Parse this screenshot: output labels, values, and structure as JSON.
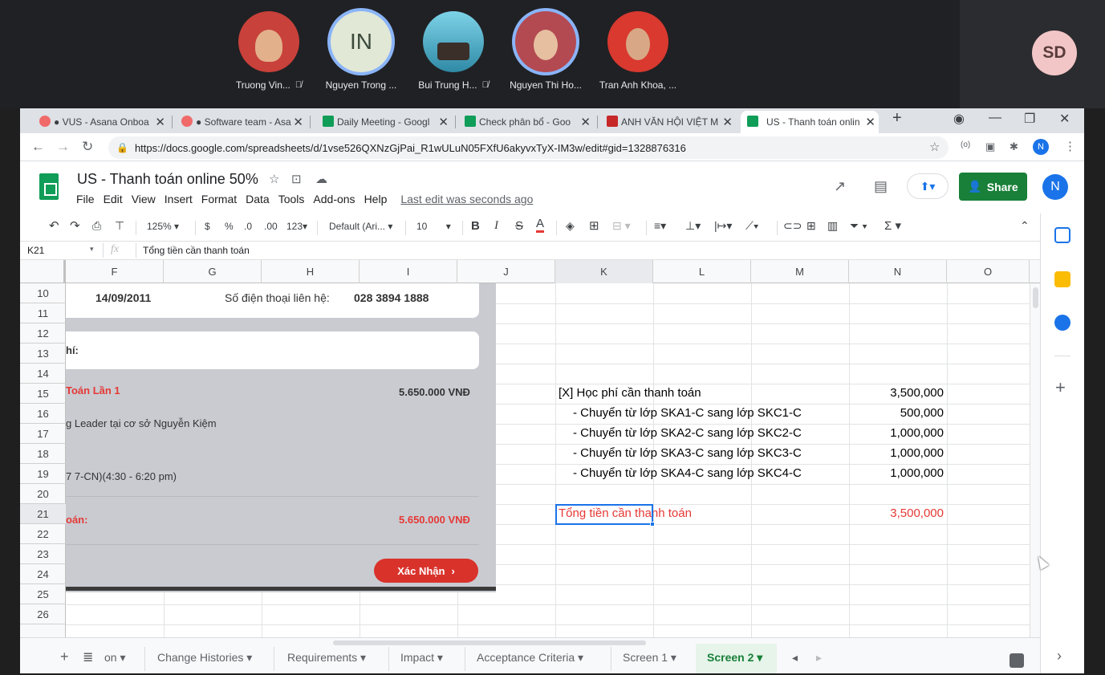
{
  "meeting": {
    "participants": [
      {
        "name": "Truong Vin...",
        "initials": "",
        "muted": true,
        "photo_color": "#c8413a",
        "ring": false
      },
      {
        "name": "Nguyen Trong ...",
        "initials": "IN",
        "muted": false,
        "photo_color": "#e2e8d6",
        "ring": true
      },
      {
        "name": "Bui Trung H...",
        "initials": "",
        "muted": true,
        "photo_color": "#49b6c9",
        "ring": false
      },
      {
        "name": "Nguyen Thi Ho...",
        "initials": "",
        "muted": false,
        "photo_color": "#b34a52",
        "ring": true
      },
      {
        "name": "Tran Anh Khoa, ...",
        "initials": "",
        "muted": false,
        "photo_color": "#d9392f",
        "ring": false
      }
    ],
    "self_initials": "SD"
  },
  "browser": {
    "tabs": [
      {
        "label": "● VUS - Asana Onboa",
        "icon_color": "#f06a6a"
      },
      {
        "label": "● Software team - Asa",
        "icon_color": "#f06a6a"
      },
      {
        "label": "Daily Meeting - Googl",
        "icon_color": "#0f9d58"
      },
      {
        "label": "Check phân bổ - Goo",
        "icon_color": "#0f9d58"
      },
      {
        "label": "ANH VĂN HỘI VIỆT M",
        "icon_color": "#c62828"
      },
      {
        "label": "US - Thanh toán onlin",
        "icon_color": "#0f9d58"
      }
    ],
    "new_tab": "+",
    "url": "https://docs.google.com/spreadsheets/d/1vse526QXNzGjPai_R1wULuN05FXfU6akyvxTyX-IM3w/edit#gid=1328876316",
    "profile_initial": "N"
  },
  "doc": {
    "title": "US - Thanh toán online 50%",
    "menu": [
      "File",
      "Edit",
      "View",
      "Insert",
      "Format",
      "Data",
      "Tools",
      "Add-ons",
      "Help"
    ],
    "last_edit": "Last edit was seconds ago",
    "share_label": "Share",
    "account_initial": "N"
  },
  "toolbar": {
    "zoom": "125%",
    "currency": "$",
    "percent": "%",
    "dec_less": ".0",
    "dec_more": ".00",
    "format_more": "123",
    "font": "Default (Ari...",
    "font_size": "10",
    "bold": "B",
    "italic": "I",
    "strike": "S",
    "text_color": "A",
    "sum": "Σ"
  },
  "formula_bar": {
    "cell_ref": "K21",
    "fx": "fx",
    "content": "Tổng tiền cần thanh toán"
  },
  "grid": {
    "columns": [
      "F",
      "G",
      "H",
      "I",
      "J",
      "K",
      "L",
      "M",
      "N",
      "O"
    ],
    "rows": [
      "10",
      "11",
      "12",
      "13",
      "14",
      "15",
      "16",
      "17",
      "18",
      "19",
      "20",
      "21",
      "22",
      "23",
      "24",
      "25",
      "26"
    ],
    "selected_column": "K",
    "selected_row": "21",
    "cells": [
      {
        "text": "[X] Học phí cần thanh toán",
        "value": "3,500,000",
        "red": false
      },
      {
        "text": "- Chuyển từ lớp SKA1-C sang lớp SKC1-C",
        "value": "500,000",
        "red": false
      },
      {
        "text": "- Chuyển từ lớp SKA2-C sang lớp SKC2-C",
        "value": "1,000,000",
        "red": false
      },
      {
        "text": "- Chuyển từ lớp SKA3-C sang lớp SKC3-C",
        "value": "1,000,000",
        "red": false
      },
      {
        "text": "- Chuyển từ lớp SKA4-C sang lớp SKC4-C",
        "value": "1,000,000",
        "red": false
      },
      {
        "text": "Tổng tiền cần thanh toán",
        "value": "3,500,000",
        "red": true
      }
    ]
  },
  "embed": {
    "date": "14/09/2011",
    "phone_label": "Số điện thoại liên hệ:",
    "phone": "028 3894 1888",
    "fee_header": "hí:",
    "installment": "Toán Lần 1",
    "installment_amount": "5.650.000 VNĐ",
    "course": "g Leader tại cơ sở Nguyễn Kiệm",
    "schedule": "7 7-CN)(4:30 - 6:20 pm)",
    "total_label": "oán:",
    "total_amount": "5.650.000 VNĐ",
    "confirm": "Xác Nhận"
  },
  "sheet_tabs": {
    "items": [
      "on",
      "Change Histories",
      "Requirements",
      "Impact",
      "Acceptance Criteria",
      "Screen 1",
      "Screen 2"
    ],
    "active": "Screen 2"
  }
}
